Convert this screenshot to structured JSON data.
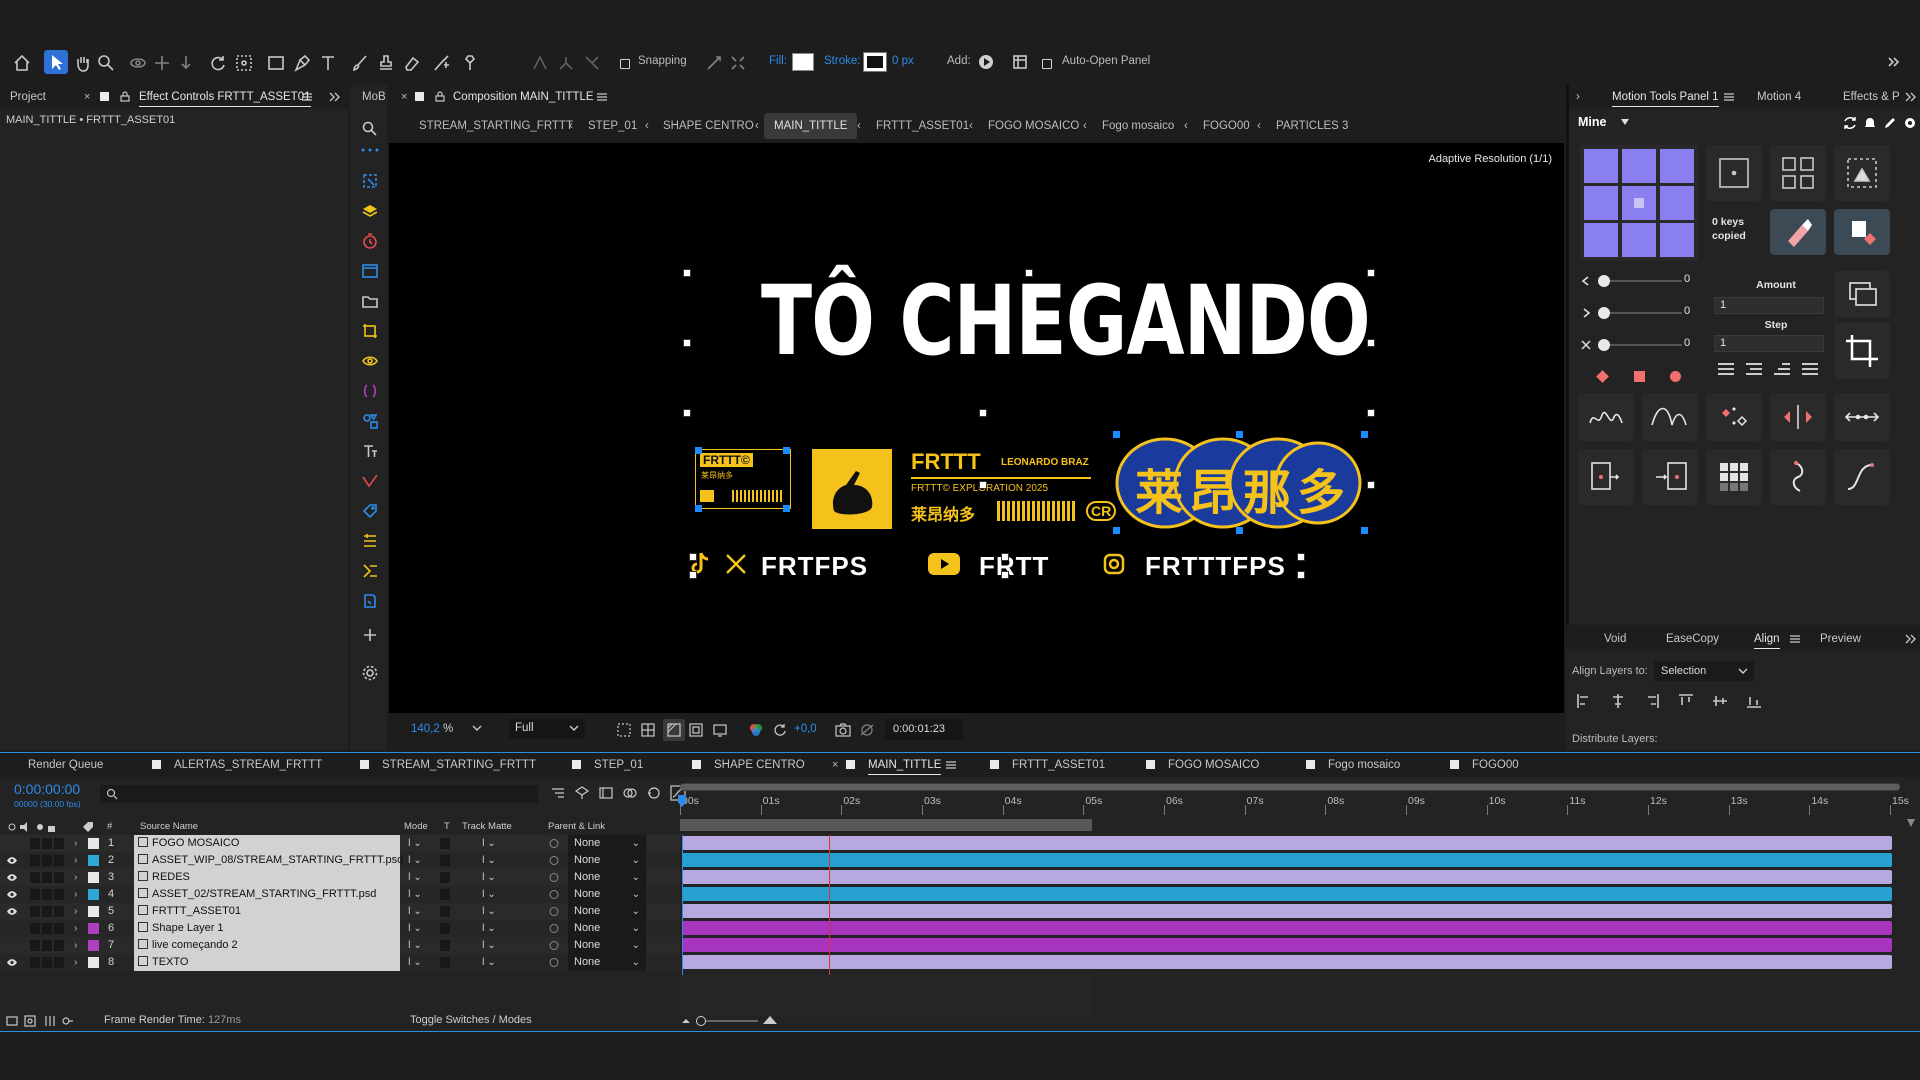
{
  "toolbar": {
    "snapping_label": "Snapping",
    "fill_label": "Fill:",
    "stroke_label": "Stroke:",
    "stroke_value": "0 px",
    "add_label": "Add:",
    "auto_open_label": "Auto-Open Panel"
  },
  "left_panel": {
    "tab_project": "Project",
    "tab_effect_controls": "Effect Controls FRTTT_ASSET01",
    "breadcrumb": "MAIN_TITTLE • FRTTT_ASSET01",
    "tab_mob": "MoB"
  },
  "composition": {
    "tab_label": "Composition MAIN_TITTLE",
    "breadcrumbs": [
      "STREAM_STARTING_FRTTT",
      "STEP_01",
      "SHAPE CENTRO",
      "MAIN_TITTLE",
      "FRTTT_ASSET01",
      "FOGO MOSAICO",
      "Fogo mosaico",
      "FOGO00",
      "PARTICLES 3"
    ],
    "adaptive_resolution": "Adaptive Resolution (1/1)",
    "zoom": "140,2",
    "zoom_unit": "%",
    "quality": "Full",
    "exposure": "+0,0",
    "timecode": "0:00:01:23"
  },
  "artwork": {
    "headline": "TÔ CHEGANDO",
    "brand_name": "FRTTT",
    "author": "LEONARDO BRAZ",
    "exploration": "FRTTT© EXPLORATION 2025",
    "cjk_small": "莱昂纳多",
    "cjk_large": "莱昂那多",
    "badge_text": "FRTTT©",
    "badge_sub": "莱昂纳多",
    "cr": "CR",
    "social_x": "FRTFPS",
    "social_youtube": "FRTT",
    "social_instagram": "FRTTTFPS"
  },
  "right_panel": {
    "tabs": [
      "Motion Tools Panel 1",
      "Motion 4",
      "Effects & P"
    ],
    "preset": "Mine",
    "keys_copied": "0 keys copied",
    "sliders": [
      "0",
      "0",
      "0"
    ],
    "amount_label": "Amount",
    "amount_value": "1",
    "step_label": "Step",
    "step_value": "1",
    "align_tabs": [
      "Void",
      "EaseCopy",
      "Align",
      "Preview"
    ],
    "align_layers_label": "Align Layers to:",
    "align_layers_value": "Selection",
    "distribute_label": "Distribute Layers:"
  },
  "timeline": {
    "tabs": [
      "Render Queue",
      "ALERTAS_STREAM_FRTTT",
      "STREAM_STARTING_FRTTT",
      "STEP_01",
      "SHAPE CENTRO",
      "MAIN_TITTLE",
      "FRTTT_ASSET01",
      "FOGO MOSAICO",
      "Fogo mosaico",
      "FOGO00"
    ],
    "timecode": "0:00:00:00",
    "fps": "00000 (30.00 fps)",
    "col_source": "Source Name",
    "col_mode": "Mode",
    "col_t": "T",
    "col_track": "Track Matte",
    "col_parent": "Parent & Link",
    "col_num": "#",
    "ruler": [
      "00s",
      "01s",
      "02s",
      "03s",
      "04s",
      "05s",
      "06s",
      "07s",
      "08s",
      "09s",
      "10s",
      "11s",
      "12s",
      "13s",
      "14s",
      "15s"
    ],
    "layers": [
      {
        "num": "1",
        "name": "FOGO MOSAICO",
        "parent": "None",
        "label_color": "#e8e8e8",
        "bar_color": "#b7a9e0"
      },
      {
        "num": "2",
        "name": "ASSET_WIP_08/STREAM_STARTING_FRTTT.psd",
        "parent": "None",
        "label_color": "#2fa7d6",
        "bar_color": "#27a1cf"
      },
      {
        "num": "3",
        "name": "REDES",
        "parent": "None",
        "label_color": "#e8e8e8",
        "bar_color": "#b7a9e0"
      },
      {
        "num": "4",
        "name": "ASSET_02/STREAM_STARTING_FRTTT.psd",
        "parent": "None",
        "label_color": "#2fa7d6",
        "bar_color": "#27a1cf"
      },
      {
        "num": "5",
        "name": "FRTTT_ASSET01",
        "parent": "None",
        "label_color": "#e8e8e8",
        "bar_color": "#b7a9e0"
      },
      {
        "num": "6",
        "name": "Shape Layer 1",
        "parent": "None",
        "label_color": "#b03fbf",
        "bar_color": "#a835bf"
      },
      {
        "num": "7",
        "name": "live começando 2",
        "parent": "None",
        "label_color": "#b03fbf",
        "bar_color": "#a835bf"
      },
      {
        "num": "8",
        "name": "TEXTO",
        "parent": "None",
        "label_color": "#e8e8e8",
        "bar_color": "#b7a9e0"
      }
    ],
    "frame_render": "Frame Render Time:",
    "frame_render_value": "127ms",
    "toggle": "Toggle Switches / Modes"
  }
}
